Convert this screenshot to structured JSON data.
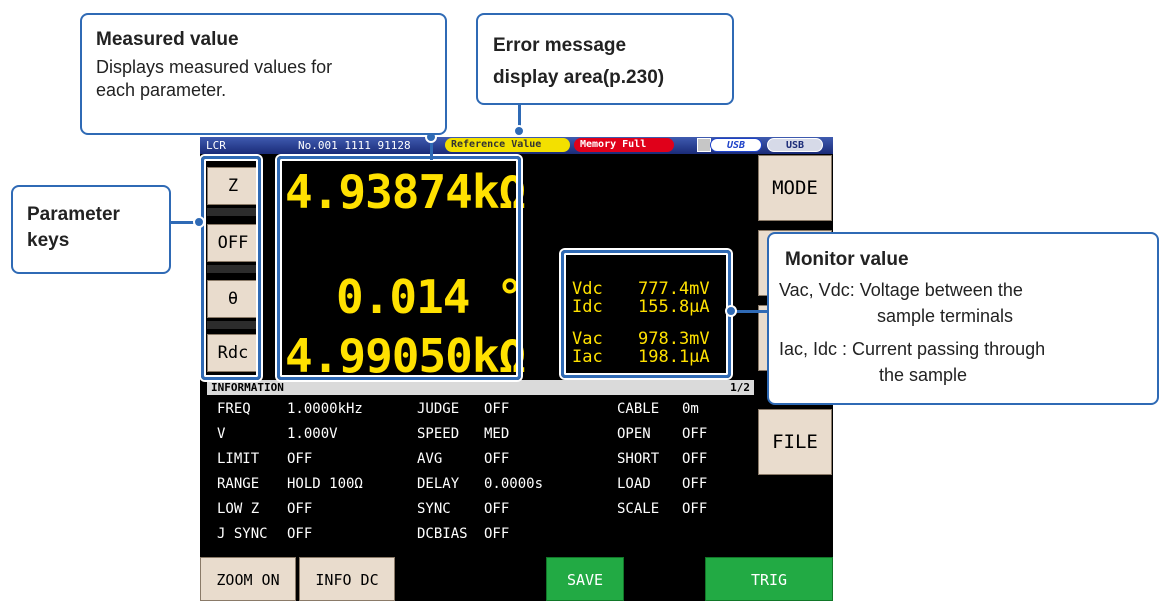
{
  "screen": {
    "title_bar": {
      "mode": "LCR",
      "file_no": "No.001 1111 91128",
      "reference_value": "Reference Value",
      "memory_full": "Memory Full",
      "usb1": "USB",
      "usb2": "USB"
    },
    "parameter_keys": [
      "Z",
      "OFF",
      "θ",
      "Rdc"
    ],
    "measured_values": [
      "4.93874kΩ",
      "0.014 °",
      "4.99050kΩ"
    ],
    "monitor": [
      {
        "label": "Vdc",
        "value": "777.4mV"
      },
      {
        "label": "Idc",
        "value": "155.8μA"
      },
      {
        "label": "Vac",
        "value": "978.3mV"
      },
      {
        "label": "Iac",
        "value": "198.1μA"
      }
    ],
    "side_buttons": {
      "mode": "MODE",
      "file": "FILE"
    },
    "information": {
      "header": "INFORMATION",
      "page": "1/2",
      "rows": [
        [
          "FREQ",
          "1.0000kHz",
          "JUDGE",
          "OFF",
          "CABLE",
          "0m"
        ],
        [
          "V",
          "1.000V",
          "SPEED",
          "MED",
          "OPEN",
          "OFF"
        ],
        [
          "LIMIT",
          "OFF",
          "AVG",
          "OFF",
          "SHORT",
          "OFF"
        ],
        [
          "RANGE",
          "HOLD   100Ω",
          "DELAY",
          "0.0000s",
          "LOAD",
          "OFF"
        ],
        [
          "LOW Z",
          "OFF",
          "SYNC",
          "OFF",
          "SCALE",
          "OFF"
        ],
        [
          "J SYNC",
          "OFF",
          "DCBIAS",
          "OFF",
          "",
          ""
        ]
      ]
    },
    "bottom_buttons": {
      "zoom_on": "ZOOM ON",
      "info_dc": "INFO DC",
      "save": "SAVE",
      "trig": "TRIG"
    }
  },
  "callouts": {
    "measured": {
      "title": "Measured value",
      "body1": "Displays measured values for",
      "body2": "each parameter."
    },
    "error": {
      "line1": "Error message",
      "line2": "display area(p.230)"
    },
    "parameter": {
      "line1": "Parameter",
      "line2": "keys"
    },
    "monitor": {
      "title": "Monitor value",
      "line1": "Vac, Vdc: Voltage between the",
      "line2": "sample terminals",
      "line3": "Iac, Idc  : Current passing through",
      "line4": "the sample"
    }
  },
  "colors": {
    "accent": "#2f6ab5",
    "display_text": "#ffe100",
    "green_button": "#22aa44"
  }
}
